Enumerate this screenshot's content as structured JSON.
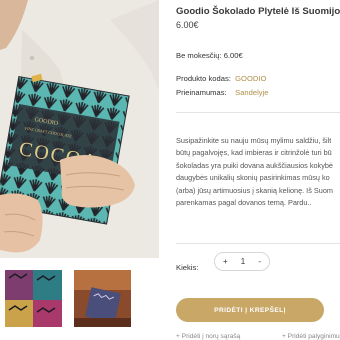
{
  "product": {
    "title": "Goodio Šokolado Plytelė Iš Suomijos",
    "price": "6.00€",
    "tax_line": "Be mokesčių: 6.00€",
    "code_label": "Produkto kodas:",
    "code_value": "GOODIO",
    "availability_label": "Prieinamumas:",
    "availability_value": "Sandelyje",
    "description_lines": [
      "Susipažinkite su nauju mūsų mylimu saldžiu, šilt",
      "būtų pagalvojęs, kad imbieras ir citrinžolė turi bū",
      "šokoladas yra puiki dovana aukščiausios kokybė",
      "daugybės unikalių skonių pasirinkimas mūsų ko",
      "(arba) jūsų artimuosius į skanią kelionę. Iš Suom",
      "parenkamas pagal dovanos temą. Pardu.."
    ],
    "image_alt": "Goodio Cocoa chocolate bar held in hands"
  },
  "purchase": {
    "qty_label": "Kiekis:",
    "qty_minus": "-",
    "qty_plus": "+",
    "qty_value": "1",
    "cart_button": "PRIDĖTI Į KREPŠELĮ",
    "wishlist_link": "+ Pridėti į norų sąrašą",
    "compare_link": "+ Pridėti palyginimu"
  },
  "colors": {
    "accent": "#c8a767",
    "link": "#b0904a",
    "package_teal": "#4fb2ad",
    "package_dark": "#2c2f36"
  }
}
